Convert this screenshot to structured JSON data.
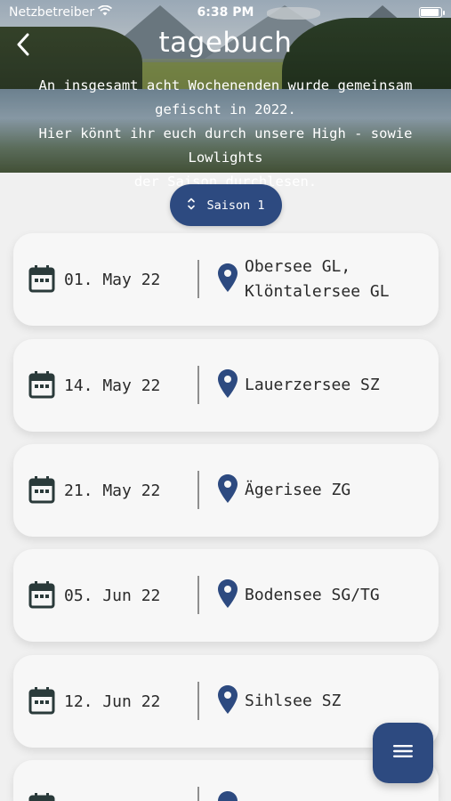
{
  "status_bar": {
    "carrier": "Netzbetreiber",
    "time": "6:38 PM",
    "icons": [
      "wifi-icon",
      "battery-icon"
    ]
  },
  "header": {
    "title": "tagebuch",
    "intro_line1": "An insgesamt acht Wochenenden wurde gemeinsam",
    "intro_line2": "gefischt in 2022.",
    "intro_line3": "Hier könnt ihr euch durch unsere High - sowie Lowlights",
    "intro_line4": "der Saison durchlesen.",
    "back_icon": "chevron-left-icon"
  },
  "season_selector": {
    "label": "Saison 1",
    "icon": "chevron-up-down-icon"
  },
  "entries": [
    {
      "date": "01. May 22",
      "location": "Obersee GL,\nKlöntalersee GL"
    },
    {
      "date": "14. May 22",
      "location": "Lauerzersee SZ"
    },
    {
      "date": "21. May 22",
      "location": "Ägerisee ZG"
    },
    {
      "date": "05. Jun 22",
      "location": "Bodensee SG/TG"
    },
    {
      "date": "12. Jun 22",
      "location": "Sihlsee SZ"
    }
  ],
  "fab": {
    "icon": "menu-icon"
  },
  "colors": {
    "accent": "#2d4a80",
    "card_background": "#f7f7f7",
    "page_background": "#f0f0f0",
    "icon_dark": "#2a3a3a"
  }
}
